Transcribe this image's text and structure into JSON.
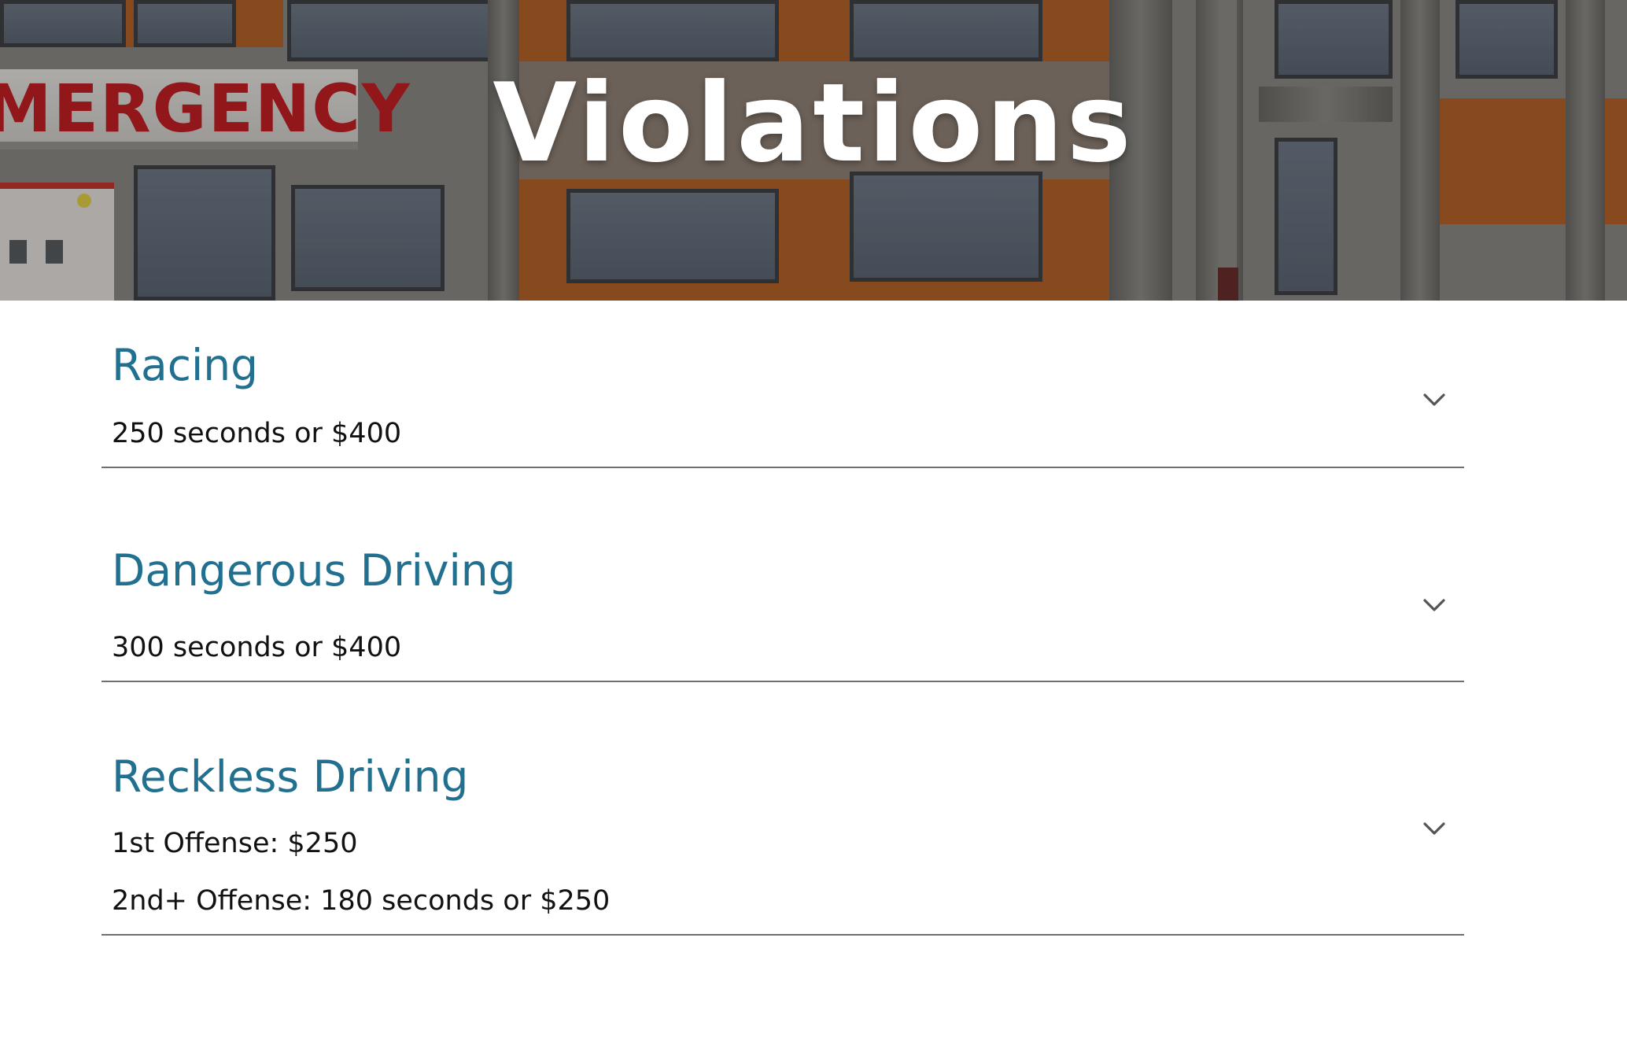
{
  "hero": {
    "title": "Violations",
    "sign_text": "MERGENCY"
  },
  "violations": [
    {
      "title": "Racing",
      "lines": [
        "250 seconds or $400"
      ]
    },
    {
      "title": "Dangerous Driving",
      "lines": [
        "300 seconds or $400"
      ]
    },
    {
      "title": "Reckless Driving",
      "lines": [
        "1st Offense: $250",
        "2nd+ Offense: 180 seconds or $250"
      ]
    }
  ],
  "icons": {
    "expand": "chevron-down-icon"
  },
  "colors": {
    "heading": "#21708f",
    "text": "#111111",
    "divider": "#6f6f6f",
    "sign_red": "#c41f25"
  }
}
